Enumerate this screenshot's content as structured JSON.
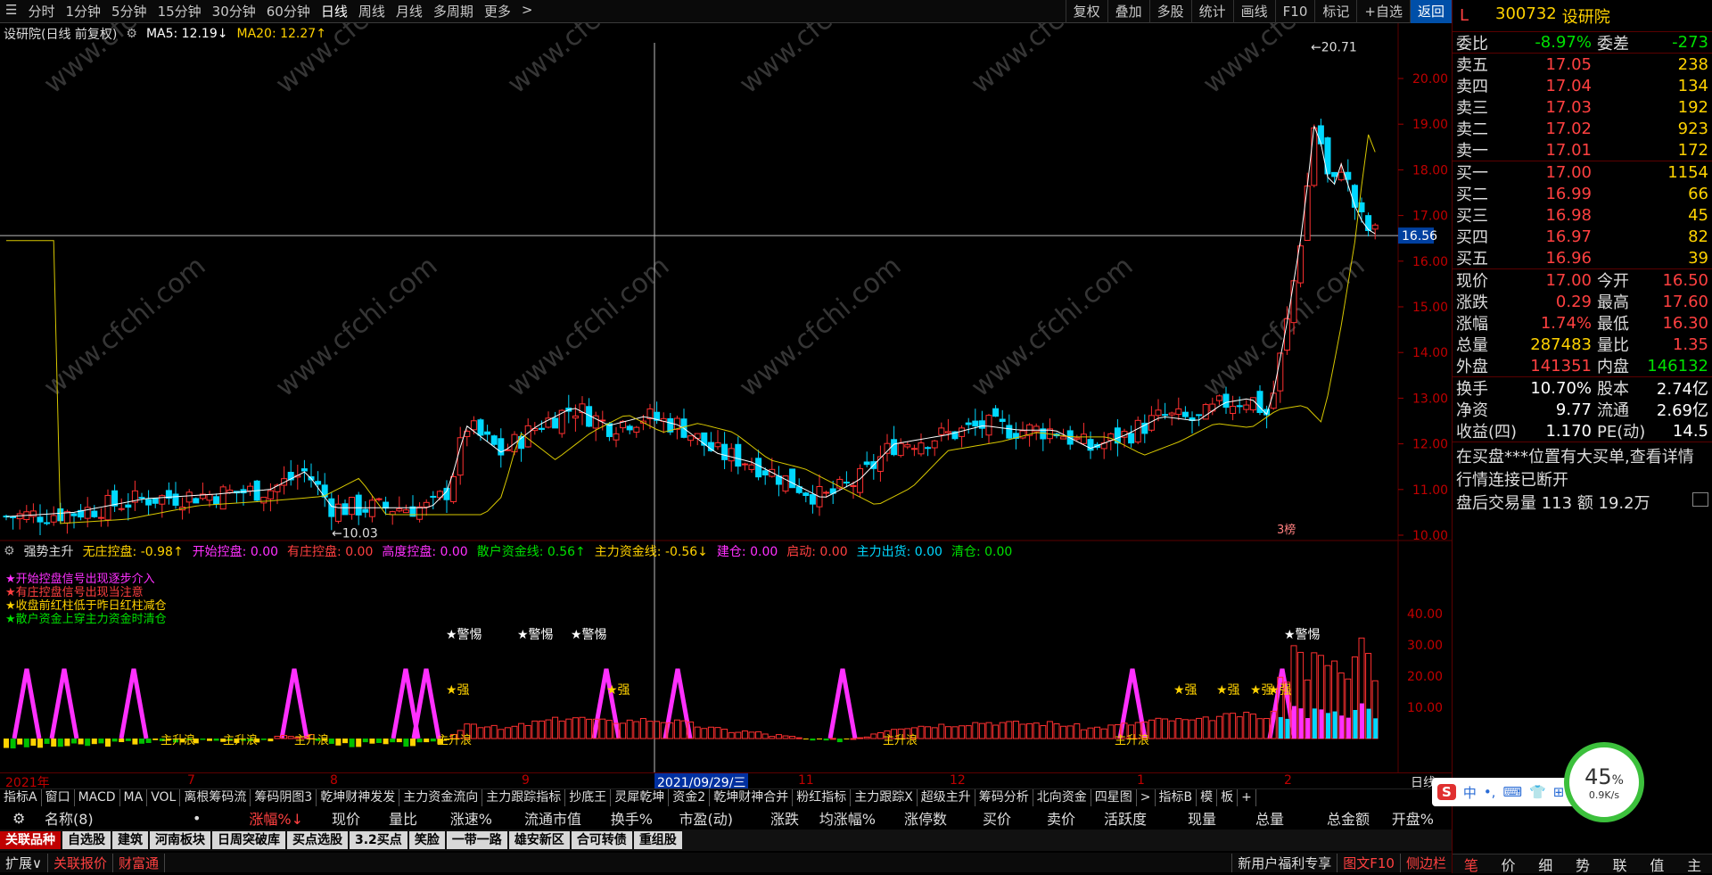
{
  "toolbar": {
    "periods": [
      "分时",
      "1分钟",
      "5分钟",
      "15分钟",
      "30分钟",
      "60分钟",
      "日线",
      "周线",
      "月线",
      "多周期",
      "更多"
    ],
    "active_period": "日线",
    "right_buttons": [
      "复权",
      "叠加",
      "多股",
      "统计",
      "画线",
      "F10",
      "标记",
      "+自选",
      "返回"
    ]
  },
  "chart": {
    "title": "设研院(日线 前复权)",
    "ma5": "MA5: 12.19↓",
    "ma20": "MA20: 12.27↑",
    "price_ticks": [
      "20.00",
      "19.00",
      "18.00",
      "17.00",
      "16.00",
      "15.00",
      "14.00",
      "13.00",
      "12.00",
      "11.00",
      "10.00"
    ],
    "current_price_tag": "16.56",
    "high_label": "20.71",
    "low_label": "10.03",
    "corner_tag": "3榜",
    "watermark": "www.cfchi.com"
  },
  "indicator": {
    "name": "强势主升",
    "items": [
      {
        "label": "无庄控盘: -0.98↑",
        "color": "#ffd200"
      },
      {
        "label": "开始控盘: 0.00",
        "color": "#ff30ff"
      },
      {
        "label": "有庄控盘: 0.00",
        "color": "#ff4040"
      },
      {
        "label": "高度控盘: 0.00",
        "color": "#ff30ff"
      },
      {
        "label": "散户资金线: 0.56↑",
        "color": "#00e000"
      },
      {
        "label": "主力资金线: -0.56↓",
        "color": "#ffd200"
      },
      {
        "label": "建仓: 0.00",
        "color": "#ff30ff"
      },
      {
        "label": "启动: 0.00",
        "color": "#ff4040"
      },
      {
        "label": "主力出货: 0.00",
        "color": "#00d8ff"
      },
      {
        "label": "清仓: 0.00",
        "color": "#00e000"
      }
    ],
    "legend": [
      {
        "text": "★开始控盘信号出现逐步介入",
        "color": "#ff30ff"
      },
      {
        "text": "★有庄控盘信号出现当注意",
        "color": "#ff4040"
      },
      {
        "text": "★收盘前红柱低于昨日红柱减仓",
        "color": "#ffd200"
      },
      {
        "text": "★散户资金上穿主力资金时清仓",
        "color": "#00e000"
      }
    ],
    "ticks": [
      "40.00",
      "30.00",
      "20.00",
      "10.00"
    ],
    "tags": {
      "warn": "★警惕",
      "strong": "★强",
      "rise": "主升浪"
    }
  },
  "timeaxis": {
    "labels": [
      "2021年",
      "7",
      "8",
      "9",
      "2021/09/29/三",
      "11",
      "12",
      "1",
      "2"
    ],
    "right_label": "日线"
  },
  "tabs": [
    "指标A",
    "窗口",
    "MACD",
    "MA",
    "VOL",
    "离根筹码流",
    "筹码阴图3",
    "乾坤财神发发",
    "主力资金流向",
    "主力跟踪指标",
    "抄底王",
    "灵犀乾坤",
    "资金2",
    "乾坤财神合并",
    "粉红指标",
    "主力跟踪X",
    "超级主升",
    "筹码分析",
    "北向资金",
    "四星图",
    ">",
    "指标B",
    "模",
    "板",
    "+"
  ],
  "columns": {
    "name": "名称(8)",
    "dot": "•",
    "cols": [
      "涨幅%↓",
      "现价",
      "量比",
      "涨速%",
      "流通市值",
      "换手%",
      "市盈(动)",
      "涨跌",
      "均涨幅%",
      "涨停数",
      "买价",
      "卖价",
      "活跃度",
      "现量",
      "总量",
      "总金额",
      "开盘%"
    ]
  },
  "sheets": [
    "关联品种",
    "自选股",
    "建筑",
    "河南板块",
    "日周突破库",
    "买点选股",
    "3.2买点",
    "笑脸",
    "一带一路",
    "雄安新区",
    "合可转债",
    "重组股"
  ],
  "active_sheet": "关联品种",
  "status": {
    "left": [
      "扩展∨",
      "关联报价",
      "财富通"
    ],
    "right": [
      "新用户福利专享",
      "图文F10",
      "侧边栏"
    ]
  },
  "quote": {
    "flag": "L",
    "code": "300732",
    "name": "设研院",
    "weibi": {
      "label": "委比",
      "value": "-8.97%",
      "label2": "委差",
      "value2": "-273"
    },
    "sell": [
      {
        "label": "卖五",
        "price": "17.05",
        "vol": "238"
      },
      {
        "label": "卖四",
        "price": "17.04",
        "vol": "134"
      },
      {
        "label": "卖三",
        "price": "17.03",
        "vol": "192"
      },
      {
        "label": "卖二",
        "price": "17.02",
        "vol": "923"
      },
      {
        "label": "卖一",
        "price": "17.01",
        "vol": "172"
      }
    ],
    "buy": [
      {
        "label": "买一",
        "price": "17.00",
        "vol": "1154"
      },
      {
        "label": "买二",
        "price": "16.99",
        "vol": "66"
      },
      {
        "label": "买三",
        "price": "16.98",
        "vol": "45"
      },
      {
        "label": "买四",
        "price": "16.97",
        "vol": "82"
      },
      {
        "label": "买五",
        "price": "16.96",
        "vol": "39"
      }
    ],
    "stats1": [
      {
        "l": "现价",
        "v": "17.00",
        "vc": "red",
        "l2": "今开",
        "v2": "16.50",
        "v2c": "red"
      },
      {
        "l": "涨跌",
        "v": "0.29",
        "vc": "red",
        "l2": "最高",
        "v2": "17.60",
        "v2c": "red"
      },
      {
        "l": "涨幅",
        "v": "1.74%",
        "vc": "red",
        "l2": "最低",
        "v2": "16.30",
        "v2c": "red"
      },
      {
        "l": "总量",
        "v": "287483",
        "vc": "yel",
        "l2": "量比",
        "v2": "1.35",
        "v2c": "red"
      },
      {
        "l": "外盘",
        "v": "141351",
        "vc": "red",
        "l2": "内盘",
        "v2": "146132",
        "v2c": "grn"
      }
    ],
    "stats2": [
      {
        "l": "换手",
        "v": "10.70%",
        "vc": "wht",
        "l2": "股本",
        "v2": "2.74亿",
        "v2c": "wht"
      },
      {
        "l": "净资",
        "v": "9.77",
        "vc": "wht",
        "l2": "流通",
        "v2": "2.69亿",
        "v2c": "wht"
      },
      {
        "l": "收益(四)",
        "v": "1.170",
        "vc": "wht",
        "l2": "PE(动)",
        "v2": "14.5",
        "v2c": "wht"
      }
    ],
    "notes": [
      "在买盘***位置有大买单,查看详情",
      "行情连接已断开",
      "盘后交易量 113 额 19.2万"
    ],
    "bottom_tabs": [
      "笔",
      "价",
      "细",
      "势",
      "联",
      "值",
      "主"
    ]
  },
  "overlay": {
    "gauge_value": "45",
    "gauge_unit": "%",
    "gauge_speed": "0.9K/s",
    "ime": [
      "S",
      "中",
      "•,",
      "⌨",
      "👕",
      "⊞"
    ]
  }
}
